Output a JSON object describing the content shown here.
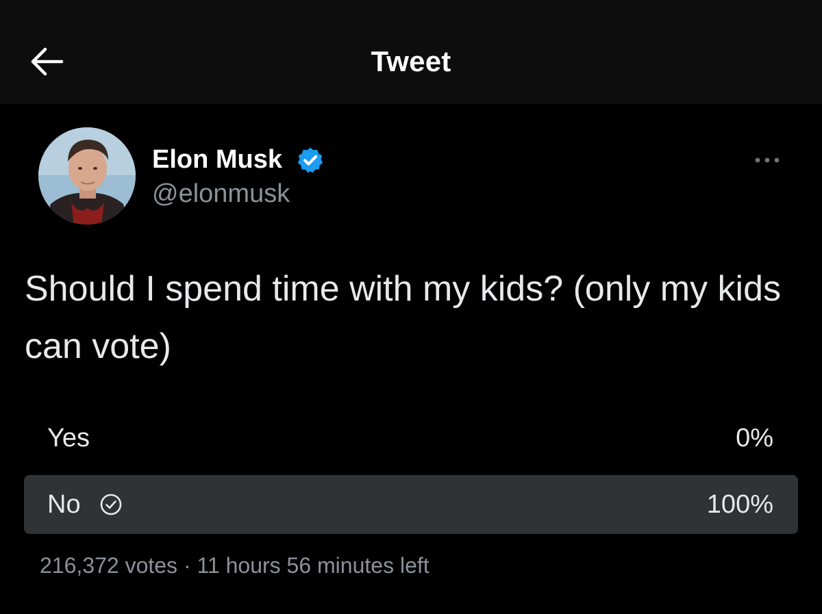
{
  "header": {
    "title": "Tweet",
    "back_icon": "arrow-left-icon"
  },
  "tweet": {
    "author": {
      "name": "Elon Musk",
      "handle": "@elonmusk",
      "verified": true,
      "verified_icon": "verified-badge-icon",
      "verified_color": "#1d9bf0"
    },
    "more_icon": "more-horizontal-icon",
    "text": "Should I spend time with my kids? (only my kids can vote)",
    "poll": {
      "options": [
        {
          "label": "Yes",
          "percent": "0%",
          "selected": false
        },
        {
          "label": "No",
          "percent": "100%",
          "selected": true
        }
      ],
      "selected_icon": "check-circle-icon",
      "votes": "216,372 votes",
      "separator": "·",
      "time_left": "11 hours 56 minutes left"
    }
  },
  "colors": {
    "background": "#000000",
    "header_background": "#0d0d0d",
    "primary_text": "#e7e9ea",
    "secondary_text": "#8b9299",
    "poll_winner_bar": "#2f3336"
  }
}
